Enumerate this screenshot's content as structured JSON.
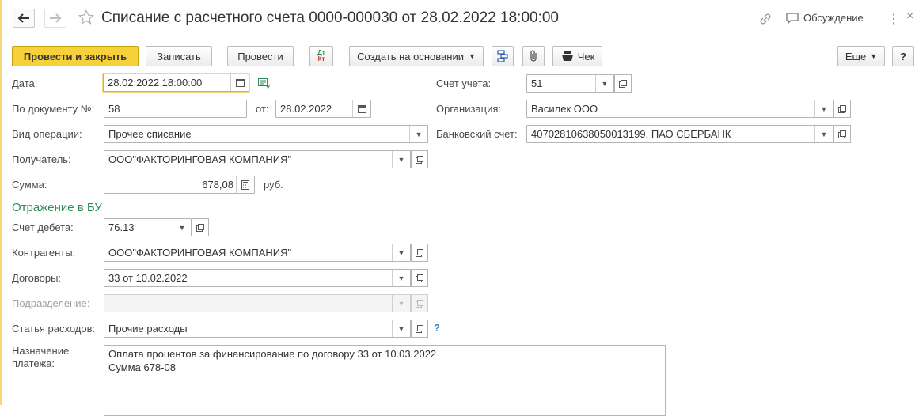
{
  "window": {
    "title": "Списание с расчетного счета 0000-000030 от 28.02.2022 18:00:00",
    "discussion_label": "Обсуждение"
  },
  "toolbar": {
    "post_close": "Провести и закрыть",
    "save": "Записать",
    "post": "Провести",
    "dt_kt": "Дт Кт",
    "create_based": "Создать на основании",
    "receipt": "Чек",
    "more": "Еще",
    "help": "?"
  },
  "form": {
    "date": {
      "label": "Дата:",
      "value": "28.02.2022 18:00:00"
    },
    "doc_number": {
      "label": "По документу №:",
      "value": "58"
    },
    "doc_date": {
      "label": "от:",
      "value": "28.02.2022"
    },
    "operation": {
      "label": "Вид операции:",
      "value": "Прочее списание"
    },
    "recipient": {
      "label": "Получатель:",
      "value": "ООО\"ФАКТОРИНГОВАЯ КОМПАНИЯ\""
    },
    "amount": {
      "label": "Сумма:",
      "value": "678,08",
      "currency": "руб."
    },
    "account": {
      "label": "Счет учета:",
      "value": "51"
    },
    "organization": {
      "label": "Организация:",
      "value": "Василек ООО"
    },
    "bank_account": {
      "label": "Банковский счет:",
      "value": "40702810638050013199, ПАО СБЕРБАНК"
    }
  },
  "bu": {
    "section_title": "Отражение в БУ",
    "debit_account": {
      "label": "Счет дебета:",
      "value": "76.13"
    },
    "counterparty": {
      "label": "Контрагенты:",
      "value": "ООО\"ФАКТОРИНГОВАЯ КОМПАНИЯ\""
    },
    "contract": {
      "label": "Договоры:",
      "value": "33 от 10.02.2022"
    },
    "department": {
      "label": "Подразделение:",
      "value": ""
    },
    "expense_item": {
      "label": "Статья расходов:",
      "value": "Прочие расходы",
      "help": "?"
    },
    "purpose": {
      "label_line1": "Назначение",
      "label_line2": "платежа:",
      "line1": "Оплата процентов за финансирование по договору 33 от 10.03.2022",
      "line2": "Сумма 678-08"
    }
  },
  "colors": {
    "primary_button": "#f7d13a",
    "section_title": "#2e8b57",
    "active_border": "#e8b500"
  }
}
